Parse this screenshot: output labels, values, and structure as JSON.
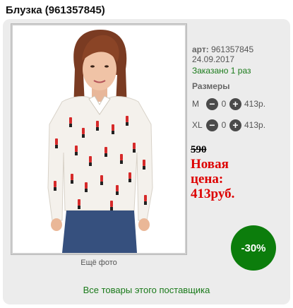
{
  "product": {
    "title": "Блузка (961357845)",
    "art_label": "арт:",
    "art_value": "961357845",
    "date": "24.09.2017",
    "tick": "'",
    "ordered": "Заказано 1 раз",
    "sizes_header": "Размеры",
    "sizes": [
      {
        "size": "M",
        "qty": "0",
        "price": "413р."
      },
      {
        "size": "XL",
        "qty": "0",
        "price": "413р."
      }
    ],
    "old_price": "590",
    "new_price_line1": "Новая",
    "new_price_line2": "цена:",
    "new_price_line3": "413руб.",
    "discount": "-30%",
    "more_photos": "Ещё фото",
    "supplier_link": "Все товары этого поставщика"
  },
  "colors": {
    "accent_green": "#1a7a1a",
    "discount_green": "#0c7d0c",
    "price_red": "#dd0000"
  }
}
